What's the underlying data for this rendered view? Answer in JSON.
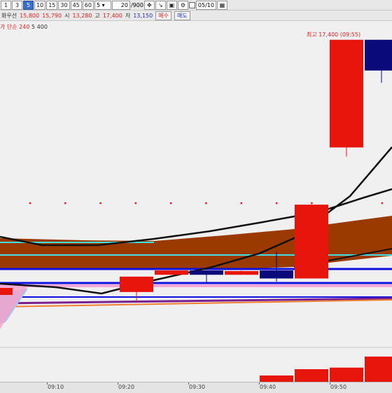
{
  "toolbar": {
    "periods": [
      "1",
      "3",
      "5",
      "10",
      "15",
      "30",
      "45",
      "60"
    ],
    "active_period": "5",
    "period_select": "5",
    "count_display": "20",
    "count_max": "/900",
    "date_value": "05/10"
  },
  "quote": {
    "stock_name": "화우선",
    "price": "15,800",
    "prev": "15,790",
    "open_label": "시",
    "open": "13,280",
    "high_label": "고",
    "high": "17,400",
    "low_label": "저",
    "low": "13,150",
    "buy_label": "매수",
    "sell_label": "매도"
  },
  "legend": {
    "prefix": "가 ",
    "ma_label": "단순 240",
    "ma_value": "5",
    "ma_extra": "400"
  },
  "annotation": "최고 17,400 (09:55)",
  "time_ticks": [
    "09:10",
    "09:20",
    "09:30",
    "09:40",
    "09:50"
  ],
  "colors": {
    "up": "#e8150d",
    "down": "#0a0a7a",
    "ma_fill": "#9b3a00",
    "bg": "#f0f0f0"
  },
  "chart_data": {
    "type": "candlestick",
    "x": [
      "09:20",
      "09:25",
      "09:30",
      "09:35",
      "09:40",
      "09:45",
      "09:50",
      "09:55"
    ],
    "candles": [
      {
        "time": "09:20",
        "open": 13300,
        "high": 13550,
        "low": 13150,
        "close": 13550,
        "dir": "up"
      },
      {
        "time": "09:25",
        "open": 13580,
        "high": 13650,
        "low": 13580,
        "close": 13650,
        "dir": "up"
      },
      {
        "time": "09:30",
        "open": 13650,
        "high": 13650,
        "low": 13450,
        "close": 13580,
        "dir": "down"
      },
      {
        "time": "09:35",
        "open": 13580,
        "high": 13650,
        "low": 13580,
        "close": 13640,
        "dir": "up"
      },
      {
        "time": "09:40",
        "open": 13650,
        "high": 13950,
        "low": 13470,
        "close": 13520,
        "dir": "down"
      },
      {
        "time": "09:45",
        "open": 13520,
        "high": 14720,
        "low": 13520,
        "close": 14720,
        "dir": "up"
      },
      {
        "time": "09:50",
        "open": 15650,
        "high": 17400,
        "low": 15500,
        "close": 17400,
        "dir": "up"
      },
      {
        "time": "09:55",
        "open": 17400,
        "high": 17400,
        "low": 16700,
        "close": 16900,
        "dir": "down"
      }
    ],
    "volume": [
      {
        "time": "09:40",
        "value": 20
      },
      {
        "time": "09:45",
        "value": 40
      },
      {
        "time": "09:50",
        "value": 45
      },
      {
        "time": "09:55",
        "value": 80
      }
    ],
    "ylim": [
      13150,
      17500
    ]
  }
}
